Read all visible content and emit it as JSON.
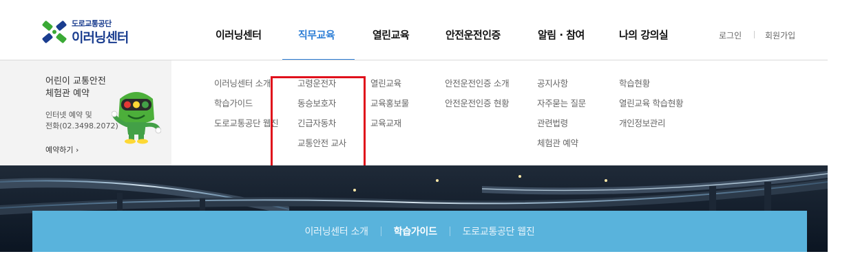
{
  "logo": {
    "org_name": "도로교통공단",
    "service_name": "이러닝센터"
  },
  "gnb": {
    "items": [
      {
        "label": "이러닝센터"
      },
      {
        "label": "직무교육",
        "active": true
      },
      {
        "label": "열린교육"
      },
      {
        "label": "안전운전인증"
      },
      {
        "label": "알림 · 참여"
      },
      {
        "label": "나의 강의실"
      }
    ],
    "login": "로그인",
    "signup": "회원가입"
  },
  "promo": {
    "title_line1": "어린이 교통안전",
    "title_line2": "체험관 예약",
    "desc_line1": "인터넷 예약 및",
    "desc_line2": "전화(02.3498.2072)",
    "link_label": "예약하기 ›"
  },
  "submenus": [
    [
      "이러닝센터 소개",
      "학습가이드",
      "도로교통공단 웹진"
    ],
    [
      "고령운전자",
      "동승보호자",
      "긴급자동차",
      "교통안전 교사"
    ],
    [
      "열린교육",
      "교육홍보물",
      "교육교재"
    ],
    [
      "안전운전인증 소개",
      "안전운전인증 현황"
    ],
    [
      "공지사항",
      "자주묻는 질문",
      "관련법령",
      "체험관 예약"
    ],
    [
      "학습현황",
      "열린교육 학습현황",
      "개인정보관리"
    ]
  ],
  "sub_bar": {
    "items": [
      {
        "label": "이러닝센터 소개"
      },
      {
        "label": "학습가이드",
        "active": true
      },
      {
        "label": "도로교통공단 웹진"
      }
    ]
  },
  "colors": {
    "accent": "#2f7fd6",
    "brand_navy": "#1a3d8f",
    "logo_green": "#3aa935",
    "highlight_red": "#e0101b",
    "sub_bar": "#59b3dc"
  }
}
